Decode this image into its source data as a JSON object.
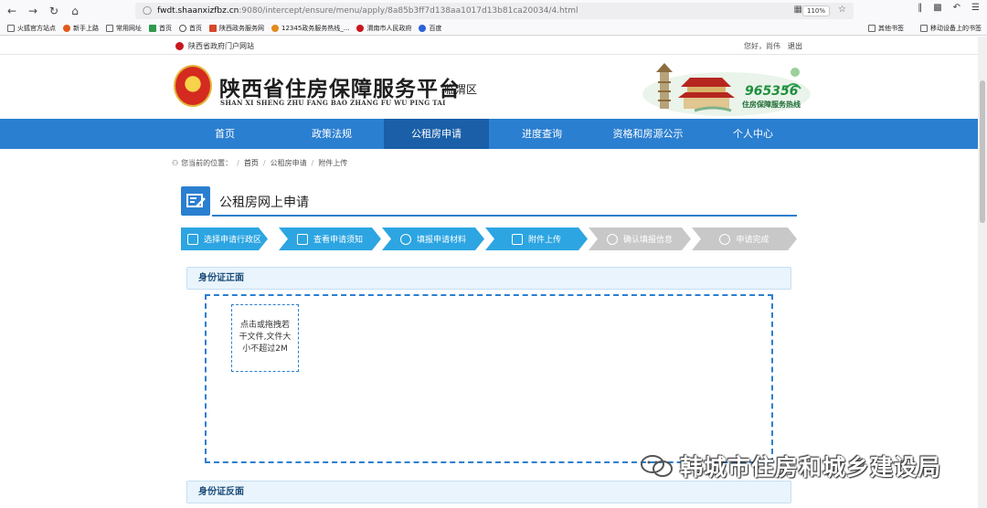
{
  "browser": {
    "url_host": "fwdt.shaanxizfbz.cn",
    "url_path": ":9080/intercept/ensure/menu/apply/8a85b3ff7d138aa1017d13b81ca20034/4.html",
    "zoom": "110%",
    "bookmarks": [
      "火狐官方站点",
      "新手上路",
      "常用网址",
      "首页",
      "首页",
      "陕西政务服务网",
      "12345政务服务热线_...",
      "渭南市人民政府",
      "百度"
    ],
    "bookmarks_right": [
      "其他书签",
      "移动设备上的书签"
    ]
  },
  "topbar": {
    "gov_portal": "陕西省政府门户网站",
    "greeting": "您好，尚伟",
    "logout": "退出"
  },
  "header": {
    "title": "陕西省住房保障服务平台",
    "subtitle": "SHAN XI SHENG ZHU FANG BAO ZHANG FU WU PING TAI",
    "district": "临渭区",
    "hotline": "965356",
    "hotline_sub": "住房保障服务热线"
  },
  "nav": {
    "items": [
      "首页",
      "政策法规",
      "公租房申请",
      "进度查询",
      "资格和房源公示",
      "个人中心"
    ],
    "active_index": 2
  },
  "breadcrumb": {
    "label": "您当前的位置：",
    "items": [
      "首页",
      "公租房申请",
      "附件上传"
    ]
  },
  "form": {
    "title": "公租房网上申请"
  },
  "steps": [
    {
      "label": "选择申请行政区",
      "state": "done"
    },
    {
      "label": "查看申请须知",
      "state": "done"
    },
    {
      "label": "填报申请材料",
      "state": "done"
    },
    {
      "label": "附件上传",
      "state": "done"
    },
    {
      "label": "确认填报信息",
      "state": "todo"
    },
    {
      "label": "申请完成",
      "state": "todo"
    }
  ],
  "sections": {
    "front": "身份证正面",
    "back": "身份证反面"
  },
  "upload": {
    "hint": "点击或拖拽若干文件,文件大小不超过2M"
  },
  "watermark": "韩城市住房和城乡建设局",
  "colors": {
    "primary": "#2b7fd0",
    "nav_active": "#1a5fa8",
    "step_done": "#2ca5e2",
    "step_todo": "#c8c8c8"
  }
}
